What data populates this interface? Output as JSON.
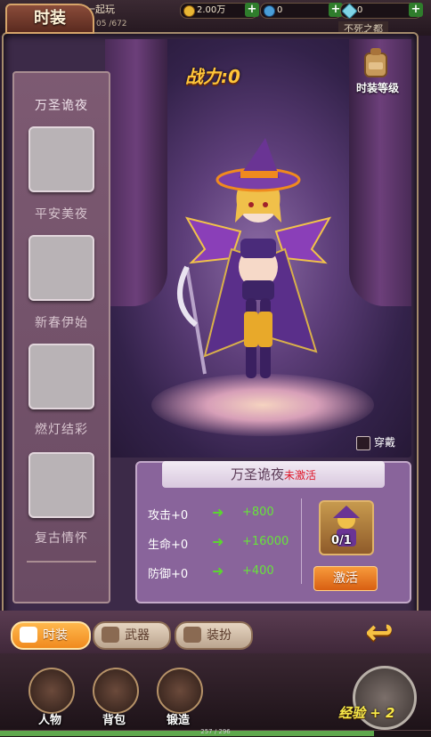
{
  "header": {
    "title": "时装",
    "behind_text": "一起玩",
    "behind_counter": "05 /672",
    "behind_location": "不死之都",
    "resources": [
      {
        "name": "gold",
        "value": "2.00万",
        "icon": "gold-coin-icon"
      },
      {
        "name": "gem-blue",
        "value": "0",
        "icon": "blue-gem-icon"
      },
      {
        "name": "gem-diamond",
        "value": "0",
        "icon": "diamond-icon"
      }
    ]
  },
  "power": {
    "label": "战力:",
    "value": "0"
  },
  "fashion_level_label": "时装等级",
  "categories": [
    {
      "label": "万圣诡夜",
      "selected": true
    },
    {
      "label": "平安美夜"
    },
    {
      "label": "新春伊始"
    },
    {
      "label": "燃灯结彩"
    },
    {
      "label": "复古情怀"
    }
  ],
  "wear_label": "穿戴",
  "costume": {
    "name": "万圣诡夜",
    "status": "未激活",
    "stats": [
      {
        "label": "攻击+0",
        "bonus": "+800"
      },
      {
        "label": "生命+0",
        "bonus": "+16000"
      },
      {
        "label": "防御+0",
        "bonus": "+400"
      }
    ],
    "item_count": "0/1",
    "activate_label": "激活"
  },
  "tabs": [
    {
      "label": "时装",
      "active": true
    },
    {
      "label": "武器"
    },
    {
      "label": "装扮"
    }
  ],
  "nav": [
    {
      "label": "人物"
    },
    {
      "label": "背包"
    },
    {
      "label": "锻造"
    }
  ],
  "exp": {
    "label": "经验 + 2",
    "progress_text": "257 / 296",
    "fraction": 0.868
  },
  "colors": {
    "accent_orange": "#f08a1e",
    "power_gold": "#ffc63a",
    "stat_green": "#67e33b",
    "status_red": "#e0192a"
  }
}
